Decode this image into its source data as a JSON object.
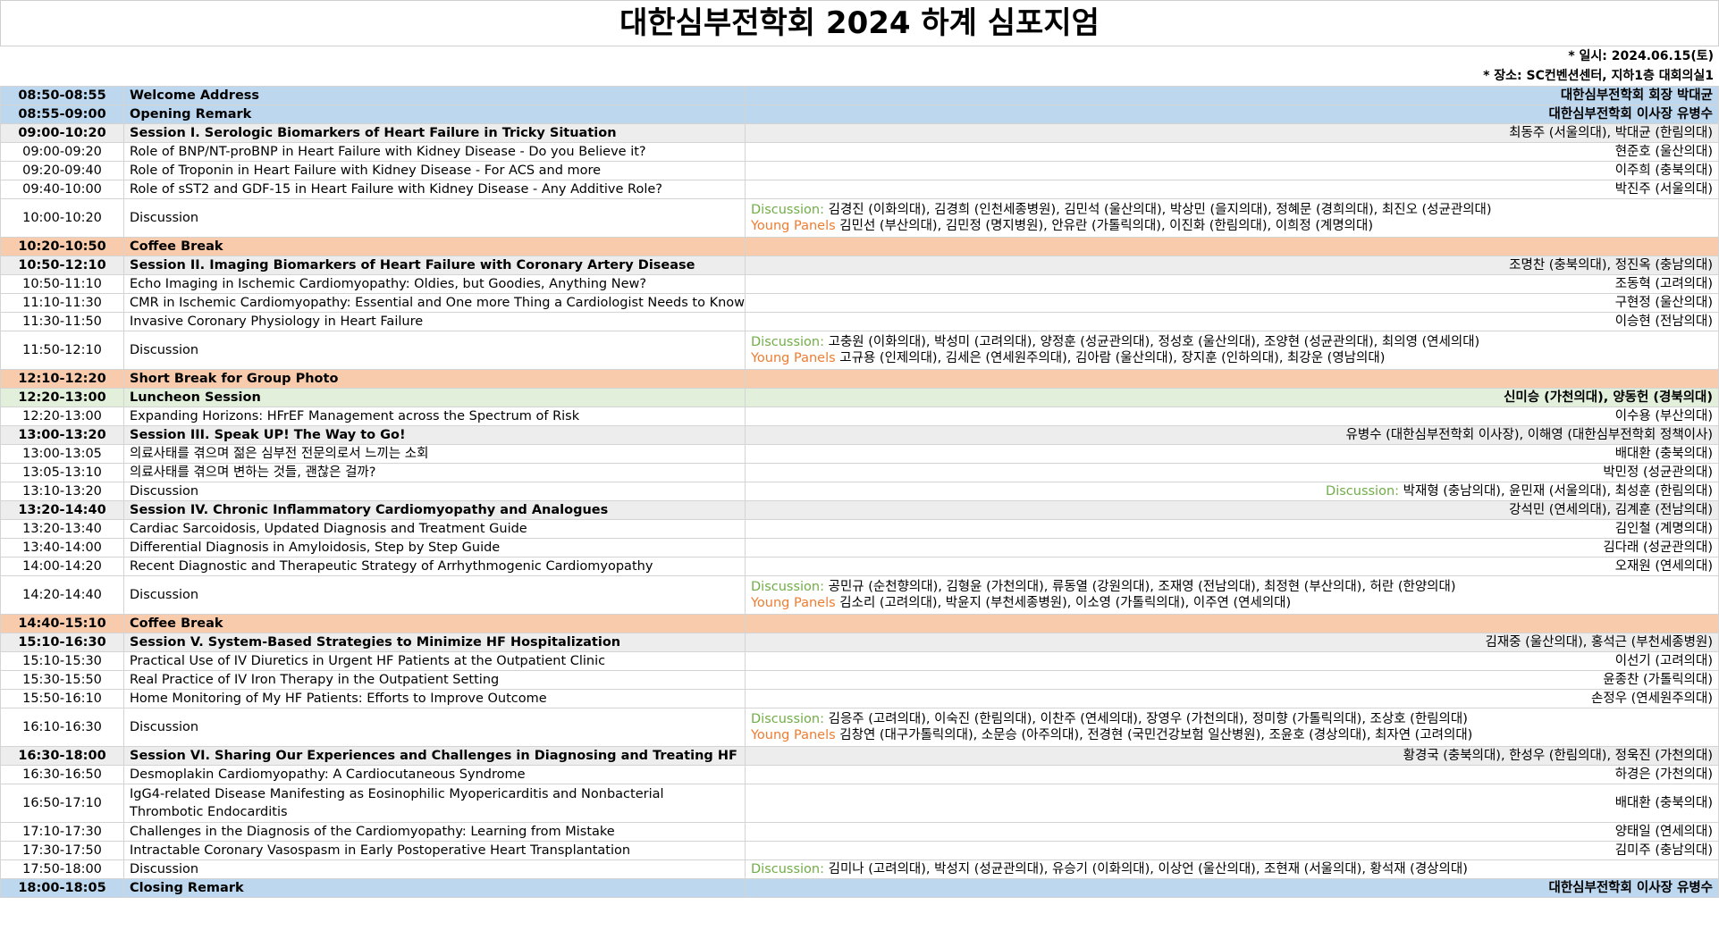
{
  "title": "대한심부전학회 2024 하계 심포지엄",
  "meta": {
    "date": "* 일시: 2024.06.15(토)",
    "place": "* 장소: SC컨벤션센터, 지하1층 대회의실1"
  },
  "labels": {
    "discussion": "Discussion:",
    "young": "Young Panels"
  },
  "rows": [
    {
      "type": "welcome",
      "time": "08:50-08:55",
      "title": "Welcome Address",
      "speaker": "대한심부전학회 회장 박대균"
    },
    {
      "type": "welcome",
      "time": "08:55-09:00",
      "title": "Opening Remark",
      "speaker": "대한심부전학회 이사장 유병수"
    },
    {
      "type": "session",
      "time": "09:00-10:20",
      "title": "Session I. Serologic Biomarkers of Heart Failure in Tricky Situation",
      "speaker": "최동주 (서울의대), 박대균 (한림의대)"
    },
    {
      "type": "talk",
      "time": "09:00-09:20",
      "title": "Role of BNP/NT-proBNP in Heart Failure with Kidney Disease - Do you Believe it?",
      "speaker": "현준호 (울산의대)"
    },
    {
      "type": "talk",
      "time": "09:20-09:40",
      "title": "Role of Troponin in Heart Failure with Kidney Disease - For ACS and more",
      "speaker": "이주희 (충북의대)"
    },
    {
      "type": "talk",
      "time": "09:40-10:00",
      "title": "Role of sST2 and GDF-15 in Heart Failure with Kidney Disease - Any Additive Role?",
      "speaker": "박진주 (서울의대)"
    },
    {
      "type": "disc",
      "time": "10:00-10:20",
      "title": "Discussion",
      "disc": "김경진 (이화의대), 김경희 (인천세종병원), 김민석 (울산의대), 박상민 (을지의대), 정혜문 (경희의대), 최진오 (성균관의대)",
      "young": "김민선 (부산의대), 김민정 (명지병원), 안유란 (가톨릭의대), 이진화 (한림의대), 이희정 (계명의대)"
    },
    {
      "type": "coffee",
      "time": "10:20-10:50",
      "title": "Coffee Break",
      "speaker": ""
    },
    {
      "type": "session",
      "time": "10:50-12:10",
      "title": "Session II. Imaging Biomarkers of Heart Failure with Coronary Artery Disease",
      "speaker": "조명찬 (충북의대), 정진옥 (충남의대)"
    },
    {
      "type": "talk",
      "time": "10:50-11:10",
      "title": "Echo Imaging in Ischemic Cardiomyopathy: Oldies, but Goodies, Anything New?",
      "speaker": "조동혁 (고려의대)"
    },
    {
      "type": "talk",
      "time": "11:10-11:30",
      "title": "CMR in Ischemic Cardiomyopathy: Essential and One more Thing a Cardiologist Needs to Know",
      "speaker": "구현정 (울산의대)"
    },
    {
      "type": "talk",
      "time": "11:30-11:50",
      "title": "Invasive Coronary Physiology in Heart Failure",
      "speaker": "이승현 (전남의대)"
    },
    {
      "type": "disc",
      "time": "11:50-12:10",
      "title": "Discussion",
      "disc": "고충원 (이화의대), 박성미 (고려의대), 양정훈 (성균관의대), 정성호 (울산의대), 조양현 (성균관의대), 최의영 (연세의대)",
      "young": "고규용 (인제의대), 김세은 (연세원주의대), 김아람 (울산의대), 장지훈 (인하의대), 최강운 (영남의대)"
    },
    {
      "type": "coffee",
      "time": "12:10-12:20",
      "title": "Short Break for Group Photo",
      "speaker": ""
    },
    {
      "type": "lunch",
      "time": "12:20-13:00",
      "title": "Luncheon Session",
      "speaker": "신미승 (가천의대), 양동헌 (경북의대)"
    },
    {
      "type": "talk",
      "time": "12:20-13:00",
      "title": "Expanding Horizons: HFrEF Management across the Spectrum of Risk",
      "speaker": "이수용 (부산의대)"
    },
    {
      "type": "session",
      "time": "13:00-13:20",
      "title": "Session III. Speak UP! The Way to Go!",
      "speaker": "유병수 (대한심부전학회 이사장), 이해영 (대한심부전학회 정책이사)"
    },
    {
      "type": "talk",
      "time": "13:00-13:05",
      "title": "의료사태를 겪으며 젊은 심부전 전문의로서 느끼는 소회",
      "speaker": "배대환 (충북의대)"
    },
    {
      "type": "talk",
      "time": "13:05-13:10",
      "title": "의료사태를 겪으며 변하는 것들, 괜찮은 걸까?",
      "speaker": "박민정 (성균관의대)"
    },
    {
      "type": "disc1",
      "time": "13:10-13:20",
      "title": "Discussion",
      "disc": "박재형 (충남의대), 윤민재 (서울의대), 최성훈 (한림의대)"
    },
    {
      "type": "session",
      "time": "13:20-14:40",
      "title": "Session IV. Chronic Inflammatory Cardiomyopathy and Analogues",
      "speaker": "강석민 (연세의대), 김계훈 (전남의대)"
    },
    {
      "type": "talk",
      "time": "13:20-13:40",
      "title": "Cardiac Sarcoidosis, Updated Diagnosis and Treatment Guide",
      "speaker": "김인철 (계명의대)"
    },
    {
      "type": "talk",
      "time": "13:40-14:00",
      "title": "Differential Diagnosis in Amyloidosis, Step by Step Guide",
      "speaker": "김다래 (성균관의대)"
    },
    {
      "type": "talk",
      "time": "14:00-14:20",
      "title": "Recent Diagnostic and Therapeutic Strategy of Arrhythmogenic Cardiomyopathy",
      "speaker": "오재원 (연세의대)"
    },
    {
      "type": "disc",
      "time": "14:20-14:40",
      "title": "Discussion",
      "disc": "공민규 (순천향의대), 김형윤 (가천의대), 류동열 (강원의대), 조재영 (전남의대), 최정현 (부산의대), 허란 (한양의대)",
      "young": "김소리 (고려의대), 박윤지 (부천세종병원), 이소영 (가톨릭의대), 이주연 (연세의대)"
    },
    {
      "type": "coffee",
      "time": "14:40-15:10",
      "title": "Coffee Break",
      "speaker": ""
    },
    {
      "type": "session",
      "time": "15:10-16:30",
      "title": "Session V. System-Based Strategies to Minimize HF Hospitalization",
      "speaker": "김재중 (울산의대), 홍석근 (부천세종병원)"
    },
    {
      "type": "talk",
      "time": "15:10-15:30",
      "title": "Practical Use of IV Diuretics in Urgent HF Patients at the Outpatient Clinic",
      "speaker": "이선기 (고려의대)"
    },
    {
      "type": "talk",
      "time": "15:30-15:50",
      "title": "Real Practice of IV Iron Therapy in the Outpatient Setting",
      "speaker": "윤종찬 (가톨릭의대)"
    },
    {
      "type": "talk",
      "time": "15:50-16:10",
      "title": "Home Monitoring of My HF Patients: Efforts to Improve Outcome",
      "speaker": "손정우 (연세원주의대)"
    },
    {
      "type": "disc",
      "time": "16:10-16:30",
      "title": "Discussion",
      "disc": "김응주 (고려의대), 이숙진 (한림의대), 이찬주 (연세의대), 장영우 (가천의대), 정미향 (가톨릭의대), 조상호 (한림의대)",
      "young": " 김창연 (대구가톨릭의대), 소문승 (아주의대), 전경현 (국민건강보험 일산병원), 조윤호 (경상의대), 최자연 (고려의대)"
    },
    {
      "type": "session",
      "time": "16:30-18:00",
      "title": "Session VI. Sharing Our Experiences and Challenges in Diagnosing and Treating HF",
      "speaker": "황경국 (충북의대), 한성우 (한림의대), 정욱진 (가천의대)"
    },
    {
      "type": "talk",
      "time": "16:30-16:50",
      "title": "Desmoplakin Cardiomyopathy: A Cardiocutaneous Syndrome",
      "speaker": "하경은 (가천의대)"
    },
    {
      "type": "talk2",
      "time": "16:50-17:10",
      "title": "IgG4-related Disease Manifesting as Eosinophilic Myopericarditis and Nonbacterial Thrombotic Endocarditis",
      "speaker": "배대환 (충북의대)"
    },
    {
      "type": "talk",
      "time": "17:10-17:30",
      "title": "Challenges in the Diagnosis of the Cardiomyopathy: Learning from Mistake",
      "speaker": "양태일 (연세의대)"
    },
    {
      "type": "talk",
      "time": "17:30-17:50",
      "title": "Intractable Coronary Vasospasm in Early Postoperative Heart Transplantation",
      "speaker": "김미주 (충남의대)"
    },
    {
      "type": "discl",
      "time": "17:50-18:00",
      "title": "Discussion",
      "disc": "김미나 (고려의대), 박성지 (성균관의대), 유승기 (이화의대), 이상언 (울산의대), 조현재 (서울의대), 황석재 (경상의대)"
    },
    {
      "type": "welcome",
      "time": "18:00-18:05",
      "title": "Closing Remark",
      "speaker": "대한심부전학회 이사장 유병수"
    }
  ]
}
